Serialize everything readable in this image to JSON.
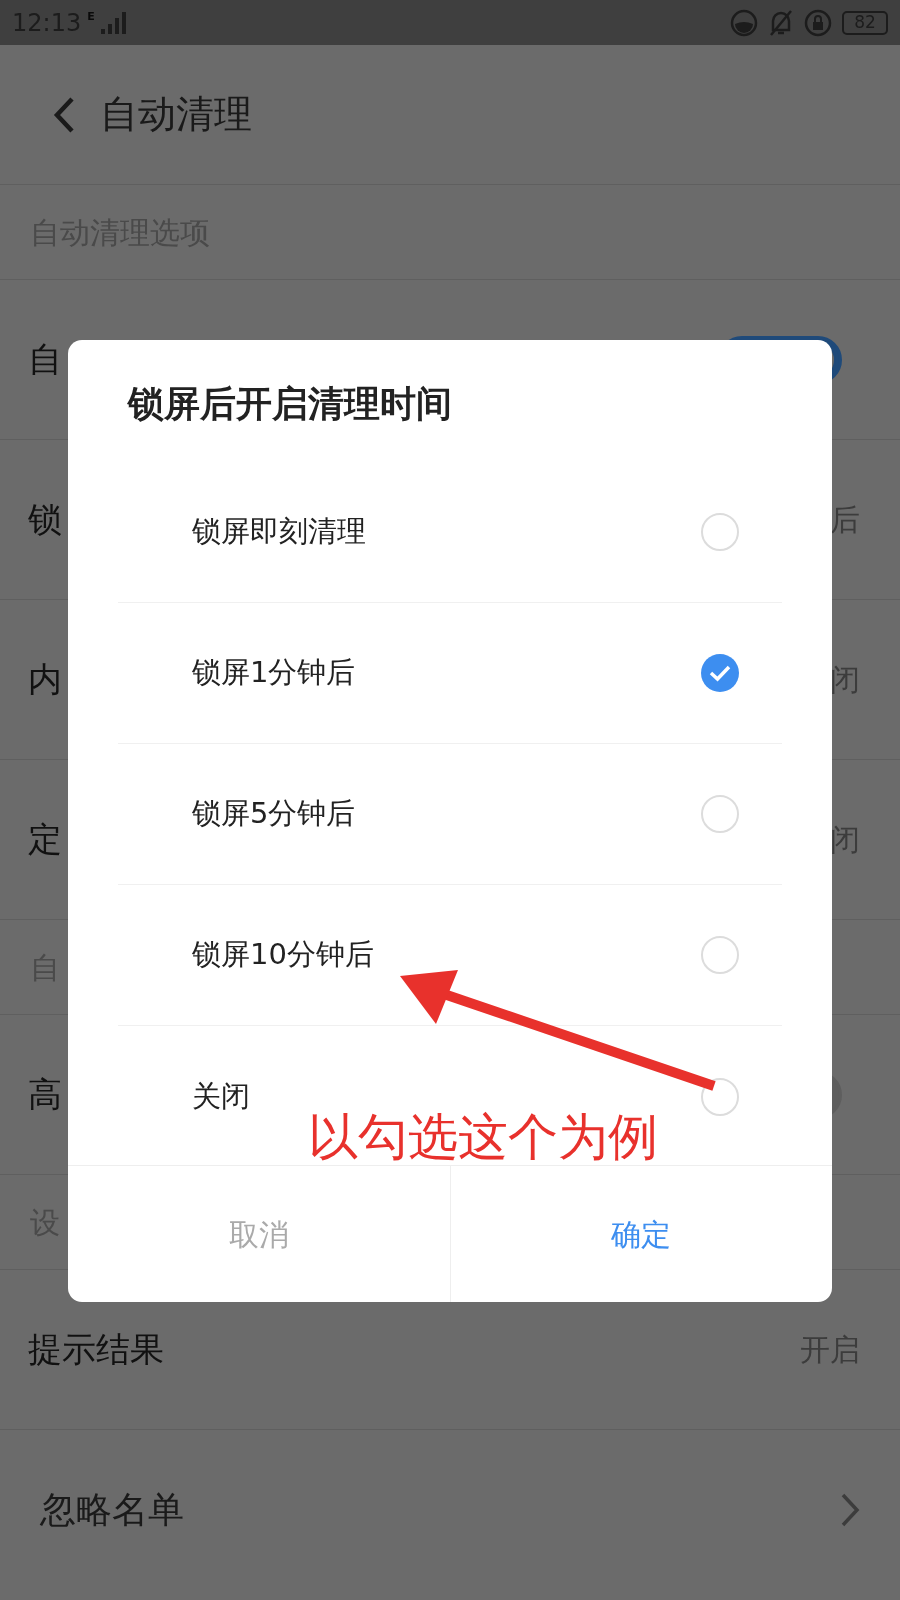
{
  "status_bar": {
    "time": "12:13",
    "network": "E",
    "battery": "82"
  },
  "header": {
    "title": "自动清理"
  },
  "settings": [
    {
      "kind": "section",
      "label": "自动清理选项"
    },
    {
      "kind": "toggle",
      "label": "自",
      "on": true
    },
    {
      "kind": "value",
      "label": "锁",
      "value": "后"
    },
    {
      "kind": "value",
      "label": "内",
      "value": "闭"
    },
    {
      "kind": "value",
      "label": "定",
      "value": "闭"
    },
    {
      "kind": "section",
      "label": "自"
    },
    {
      "kind": "toggle",
      "label": "高",
      "on": false
    },
    {
      "kind": "section",
      "label": "设"
    },
    {
      "kind": "value",
      "label": "提示结果",
      "value": "开启"
    },
    {
      "kind": "link",
      "label": "忽略名单"
    }
  ],
  "dialog": {
    "title": "锁屏后开启清理时间",
    "options": [
      {
        "label": "锁屏即刻清理",
        "selected": false
      },
      {
        "label": "锁屏1分钟后",
        "selected": true
      },
      {
        "label": "锁屏5分钟后",
        "selected": false
      },
      {
        "label": "锁屏10分钟后",
        "selected": false
      },
      {
        "label": "关闭",
        "selected": false
      }
    ],
    "buttons": [
      {
        "label": "取消",
        "kind": "cancel"
      },
      {
        "label": "确定",
        "kind": "confirm"
      }
    ]
  },
  "annotation": {
    "text": "以勾选这个为例"
  }
}
